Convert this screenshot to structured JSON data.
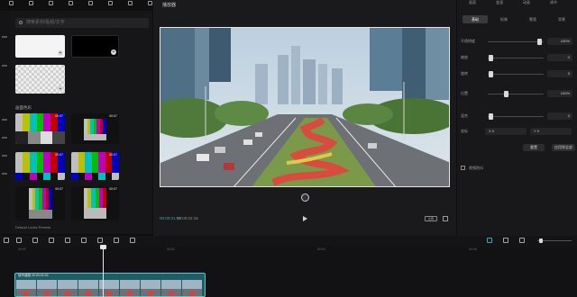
{
  "menu": [
    "",
    "",
    "",
    "",
    "",
    "",
    "",
    "",
    "",
    ""
  ],
  "media": {
    "search_placeholder": "搜索素材/贴纸/文字",
    "section_label": "画面色彩",
    "bottom_text": "Default Looks Presets",
    "durations": [
      "00:07",
      "00:07",
      "00:07",
      "00:07",
      "00:07",
      "00:07"
    ],
    "add_symbol": "+"
  },
  "player": {
    "title": "播放器",
    "time_current": "00:00:01:05",
    "time_total": "00:00:02:15",
    "ratio_label": "比例"
  },
  "inspector": {
    "top_tabs": [
      "画面",
      "变速",
      "动画",
      "调节"
    ],
    "tabs": [
      "基础",
      "抠像",
      "蒙版",
      "背景"
    ],
    "properties": [
      {
        "label": "不透明度",
        "value": "100%",
        "level": 0.92
      },
      {
        "label": "缩放",
        "value": "0",
        "level": 0.02
      },
      {
        "label": "旋转",
        "value": "0",
        "level": 0.02
      },
      {
        "label": "位置",
        "value": "100%",
        "level": 0.3
      },
      {
        "label": "混合",
        "value": "0",
        "level": 0.02
      }
    ],
    "coords_label": "坐标",
    "coord_x": "X 0",
    "coord_y": "Y 0",
    "reset_label": "重置",
    "apply_label": "应用到全部",
    "blend_label": "视频防抖"
  },
  "timeline": {
    "ticks": [
      "00:00",
      "00:02",
      "00:04",
      "00:06",
      "00:08",
      "00:10"
    ],
    "clip_label": "城市道路  00:00:02:15"
  },
  "colors": {
    "accent": "#3fa3b5",
    "clip": "#1d5d66",
    "clip_border": "#5dc3cf"
  }
}
